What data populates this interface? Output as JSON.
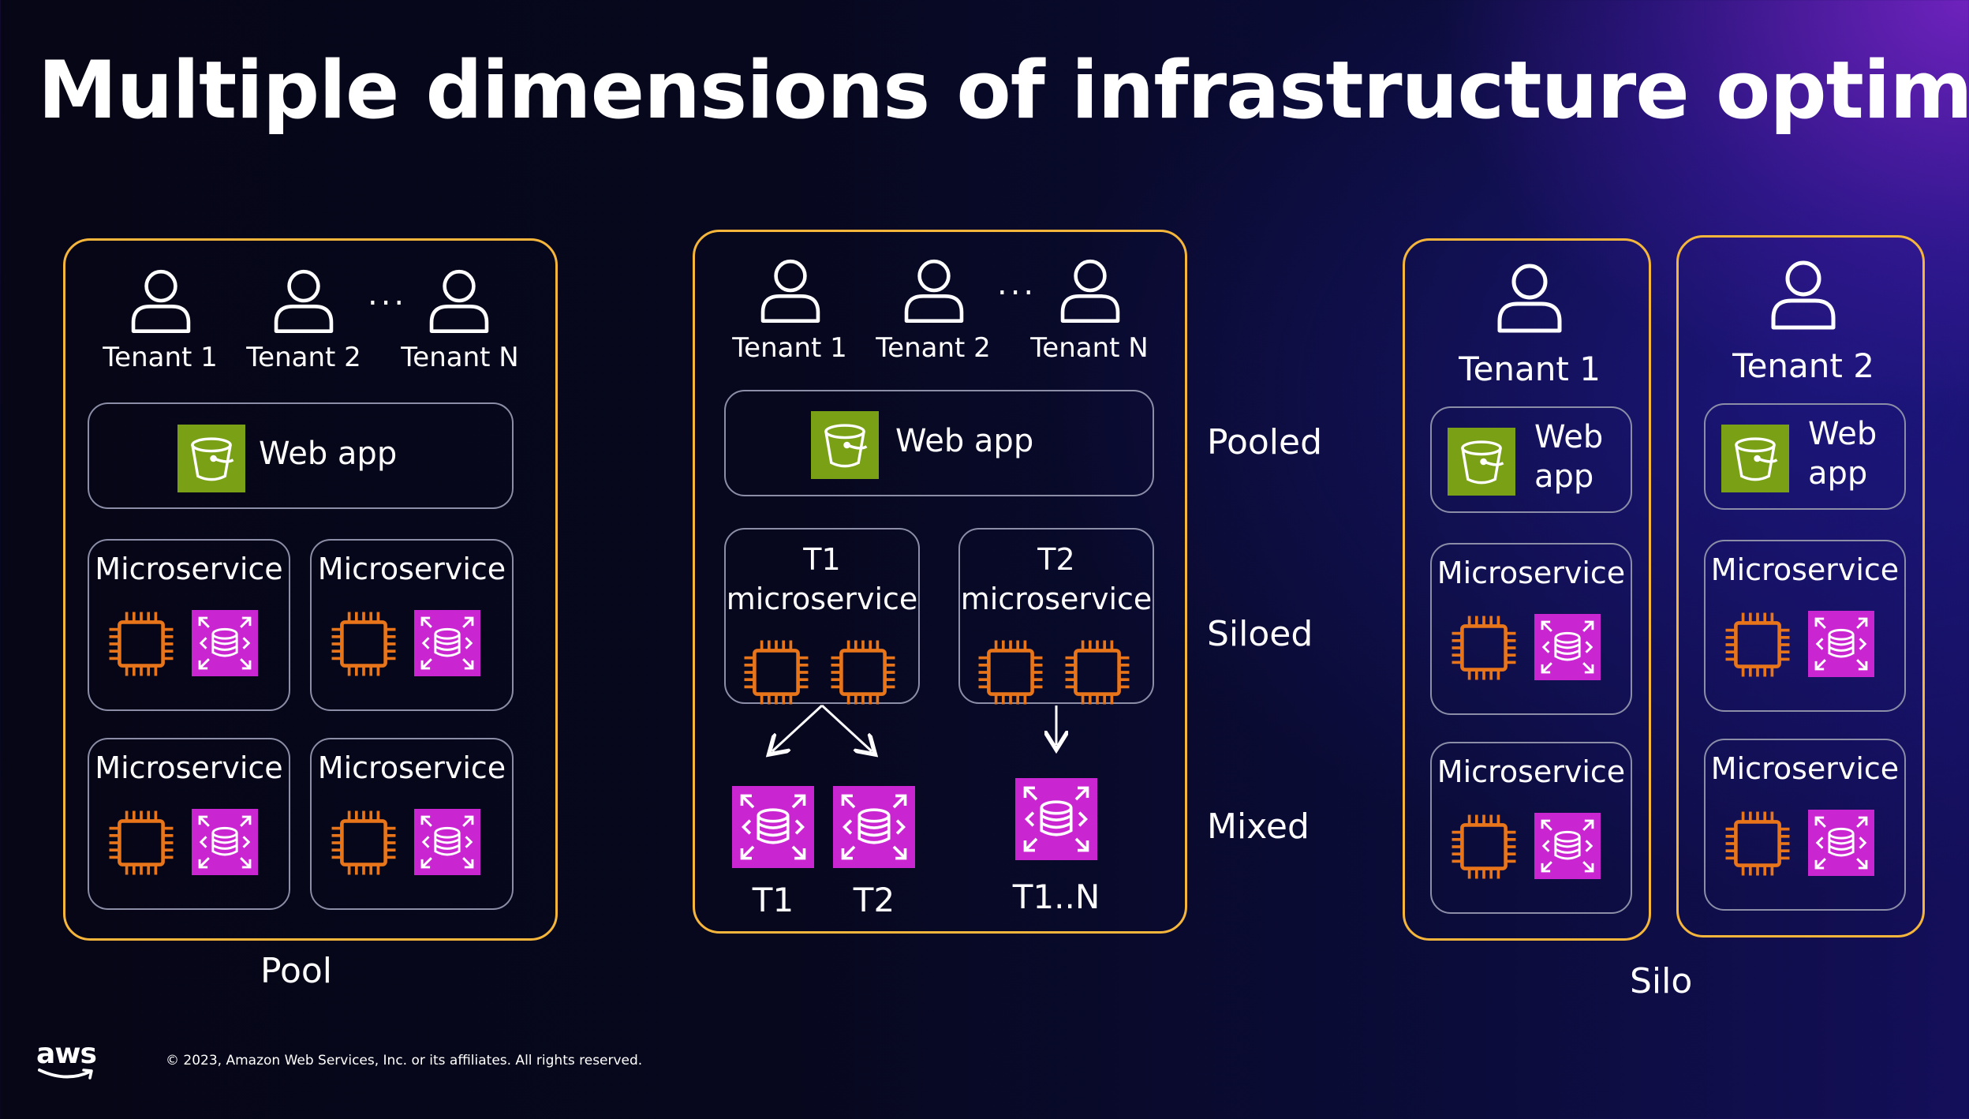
{
  "title": "Multiple dimensions of infrastructure optimization",
  "colors": {
    "container_border": "#f5b63b",
    "box_border": "#8c8ea8",
    "compute_orange": "#e8751a",
    "database_magenta": "#c925d1",
    "storage_green": "#7aa116"
  },
  "pool": {
    "caption": "Pool",
    "tenants": [
      "Tenant 1",
      "Tenant 2",
      "Tenant N"
    ],
    "ellipsis": "...",
    "web_app": "Web app",
    "microservices": [
      "Microservice",
      "Microservice",
      "Microservice",
      "Microservice"
    ]
  },
  "mixed": {
    "tenants": [
      "Tenant 1",
      "Tenant 2",
      "Tenant N"
    ],
    "ellipsis": "...",
    "web_app": "Web app",
    "t1_service": {
      "line1": "T1",
      "line2": "microservice"
    },
    "t2_service": {
      "line1": "T2",
      "line2": "microservice"
    },
    "db_labels": [
      "T1",
      "T2",
      "T1..N"
    ],
    "tiers": [
      "Pooled",
      "Siloed",
      "Mixed"
    ]
  },
  "silo": {
    "caption": "Silo",
    "stacks": [
      {
        "tenant": "Tenant 1",
        "web_app_line1": "Web",
        "web_app_line2": "app",
        "microservices": [
          "Microservice",
          "Microservice"
        ]
      },
      {
        "tenant": "Tenant 2",
        "web_app_line1": "Web",
        "web_app_line2": "app",
        "microservices": [
          "Microservice",
          "Microservice"
        ]
      }
    ]
  },
  "footer": {
    "logo": "aws",
    "copyright": "© 2023, Amazon Web Services, Inc. or its affiliates. All rights reserved."
  }
}
